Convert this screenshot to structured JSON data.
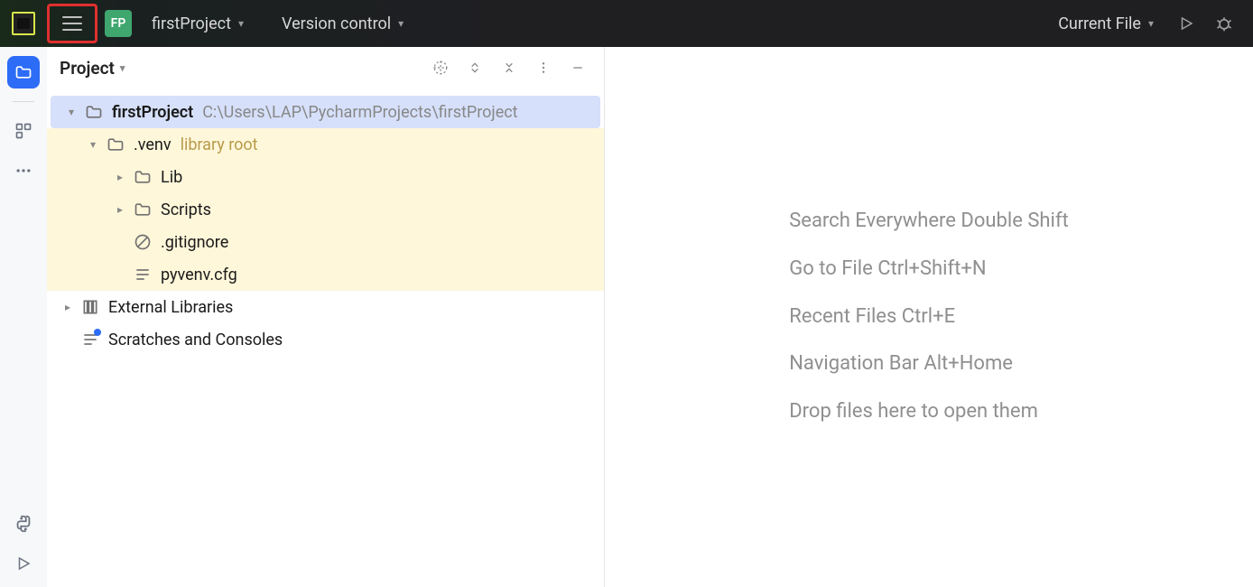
{
  "topbar": {
    "project_badge": "FP",
    "project_name": "firstProject",
    "version_control": "Version control",
    "run_target": "Current File"
  },
  "panel": {
    "title": "Project"
  },
  "tree": {
    "root": {
      "name": "firstProject",
      "path": "C:\\Users\\LAP\\PycharmProjects\\firstProject"
    },
    "venv": {
      "name": ".venv",
      "hint": "library root"
    },
    "lib": "Lib",
    "scripts": "Scripts",
    "gitignore": ".gitignore",
    "pyvenv": "pyvenv.cfg",
    "external": "External Libraries",
    "scratches": "Scratches and Consoles"
  },
  "hints": {
    "l1": "Search Everywhere Double Shift",
    "l2": "Go to File Ctrl+Shift+N",
    "l3": "Recent Files Ctrl+E",
    "l4": "Navigation Bar Alt+Home",
    "l5": "Drop files here to open them"
  }
}
